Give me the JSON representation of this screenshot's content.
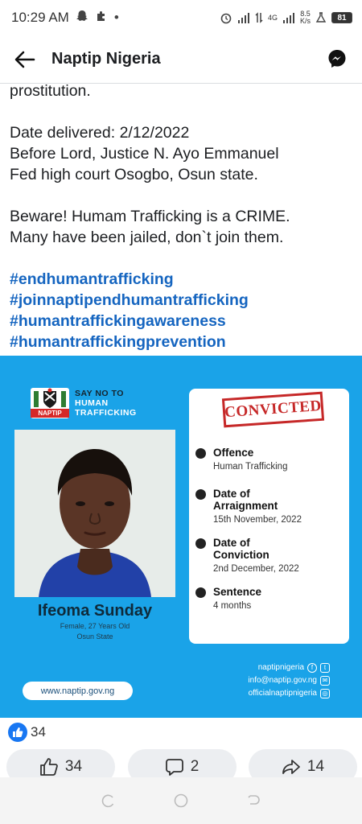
{
  "status_bar": {
    "time": "10:29 AM",
    "network": "4G",
    "speed_value": "8.5",
    "speed_unit": "K/s",
    "battery": "81"
  },
  "header": {
    "title": "Naptip Nigeria"
  },
  "post": {
    "line_top": "prostitution.",
    "date_line": "Date delivered: 2/12/2022",
    "court_line1": "Before Lord, Justice N. Ayo Emmanuel",
    "court_line2": "Fed high court Osogbo, Osun state.",
    "beware_line1": "Beware! Humam Trafficking is a CRIME.",
    "beware_line2": "Many have been jailed, don`t join them.",
    "hashtags": [
      "#endhumantrafficking",
      "#joinnaptipendhumantrafficking",
      "#humantraffickingawareness",
      "#humantraffickingprevention"
    ]
  },
  "poster": {
    "logo_text": "NAPTIP",
    "slogan_line1": "SAY NO TO",
    "slogan_line2": "HUMAN",
    "slogan_line3": "TRAFFICKING",
    "stamp": "CONVICTED",
    "name": "Ifeoma Sunday",
    "meta_line1": "Female, 27 Years Old",
    "meta_line2": "Osun State",
    "details": [
      {
        "label": "Offence",
        "value": "Human Trafficking"
      },
      {
        "label": "Date of Arraignment",
        "value": "15th November, 2022"
      },
      {
        "label": "Date of Conviction",
        "value": "2nd December, 2022"
      },
      {
        "label": "Sentence",
        "value": "4 months"
      }
    ],
    "url": "www.naptip.gov.ng",
    "social_handle": "naptipnigeria",
    "email": "info@naptip.gov.ng",
    "instagram": "officialnaptipnigeria",
    "colors": {
      "background": "#1aa3e8",
      "stamp": "#c62828"
    }
  },
  "reactions": {
    "like_count": "34"
  },
  "actions": {
    "like": "34",
    "comment": "2",
    "share": "14"
  }
}
